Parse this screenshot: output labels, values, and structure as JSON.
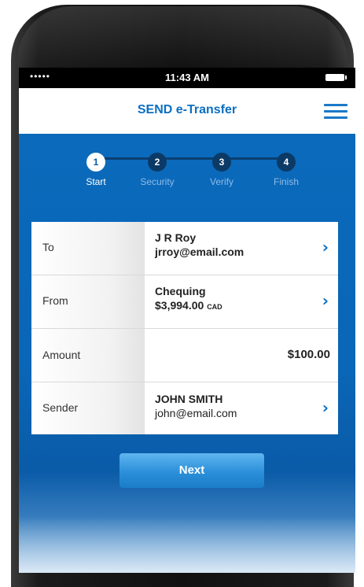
{
  "status_bar": {
    "signal": "•••••",
    "time": "11:43 AM"
  },
  "header": {
    "title": "SEND e-Transfer"
  },
  "steps": [
    {
      "number": "1",
      "label": "Start",
      "active": true
    },
    {
      "number": "2",
      "label": "Security",
      "active": false
    },
    {
      "number": "3",
      "label": "Verify",
      "active": false
    },
    {
      "number": "4",
      "label": "Finish",
      "active": false
    }
  ],
  "form": {
    "to": {
      "label": "To",
      "name": "J R Roy",
      "email": "jrroy@email.com"
    },
    "from": {
      "label": "From",
      "account": "Chequing",
      "balance": "$3,994.00",
      "currency": "CAD"
    },
    "amount": {
      "label": "Amount",
      "value": "$100.00"
    },
    "sender": {
      "label": "Sender",
      "name": "JOHN SMITH",
      "email": "john@email.com"
    }
  },
  "next_button": {
    "label": "Next"
  },
  "colors": {
    "brand_blue": "#0a6fc2",
    "screen_bg": "#0b6bbd",
    "button": "#2b8fd9"
  }
}
